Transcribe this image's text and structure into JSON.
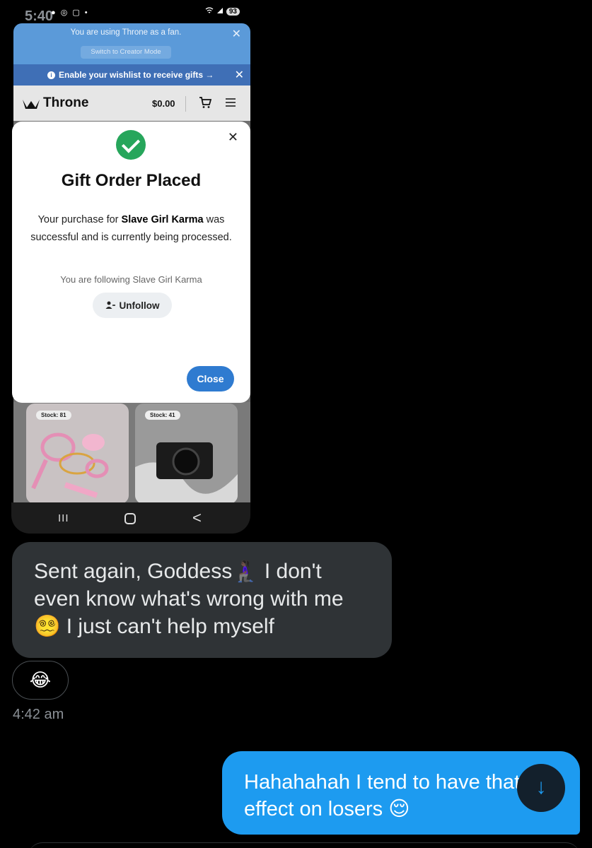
{
  "status_bar": {
    "time": "5:40",
    "left_icons": "● ◎ ▢ •",
    "battery": "93"
  },
  "fan_banner": {
    "message": "You are using Throne as a fan.",
    "switch_label": "Switch to Creator Mode",
    "close": "✕"
  },
  "wishlist_banner": {
    "info_glyph": "i",
    "message": "Enable your wishlist to receive gifts →",
    "close": "✕"
  },
  "header": {
    "brand": "Throne",
    "cart_total": "$0.00",
    "icons": [
      "crown-logo-icon",
      "cart-icon",
      "hamburger-menu-icon"
    ]
  },
  "modal": {
    "close": "✕",
    "title": "Gift Order Placed",
    "body_prefix": "Your purchase for ",
    "body_name": "Slave Girl Karma",
    "body_suffix": " was successful and is currently being processed.",
    "following_text": "You are following Slave Girl Karma",
    "unfollow_label": "Unfollow",
    "close_label": "Close"
  },
  "products": [
    {
      "stock": "Stock: 81"
    },
    {
      "stock": "Stock: 41"
    }
  ],
  "nav": {
    "recents": "III",
    "back": "<"
  },
  "chat": {
    "incoming_message": "Sent again, Goddess🧎🏿‍♀️ I don't even know what's wrong with me 😵‍💫 I just can't help myself",
    "reaction": "😂",
    "timestamp": "4:42 am",
    "outgoing_message": "Hahahahah I tend to have that effect on losers 😌",
    "scroll_down": "↓"
  },
  "colors": {
    "incoming_bubble": "#2f3336",
    "outgoing_bubble": "#1d9bf0",
    "throne_blue": "#2f7bd0",
    "success_green": "#26a65b"
  }
}
